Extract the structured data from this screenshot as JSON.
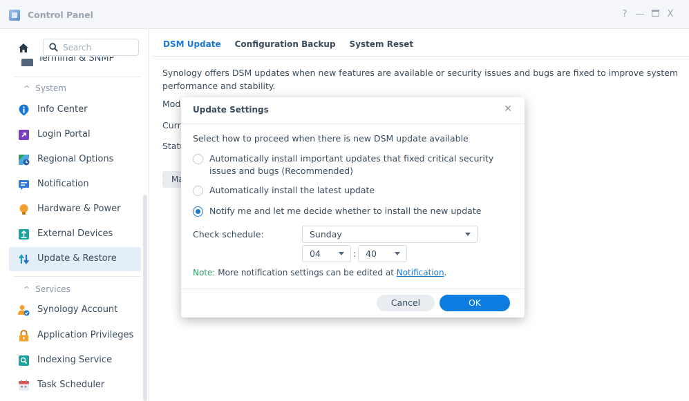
{
  "window": {
    "title": "Control Panel",
    "controls": {
      "help": "?",
      "minimize": "—",
      "maximize": "□",
      "close": "X"
    }
  },
  "sidebar": {
    "search_placeholder": "Search",
    "partial_item": "Terminal & SNMP",
    "groups": [
      {
        "title": "System",
        "items": [
          {
            "label": "Info Center",
            "icon": "info-icon",
            "color": "#1a79d5"
          },
          {
            "label": "Login Portal",
            "icon": "login-portal-icon",
            "color": "#7a3fbf"
          },
          {
            "label": "Regional Options",
            "icon": "regional-options-icon",
            "color": "#2d9c5d"
          },
          {
            "label": "Notification",
            "icon": "notification-icon",
            "color": "#2f7ad8"
          },
          {
            "label": "Hardware & Power",
            "icon": "lightbulb-icon",
            "color": "#f2a02d"
          },
          {
            "label": "External Devices",
            "icon": "external-devices-icon",
            "color": "#19a6a0"
          },
          {
            "label": "Update & Restore",
            "icon": "update-restore-icon",
            "color": "#1aa0b8",
            "active": true
          }
        ]
      },
      {
        "title": "Services",
        "items": [
          {
            "label": "Synology Account",
            "icon": "synology-account-icon",
            "color": "#f2a02d"
          },
          {
            "label": "Application Privileges",
            "icon": "lock-icon",
            "color": "#f2a02d"
          },
          {
            "label": "Indexing Service",
            "icon": "indexing-service-icon",
            "color": "#19a6a0"
          },
          {
            "label": "Task Scheduler",
            "icon": "calendar-icon",
            "color": "#e05050"
          }
        ]
      }
    ]
  },
  "main": {
    "tabs": [
      "DSM Update",
      "Configuration Backup",
      "System Reset"
    ],
    "active_tab": "DSM Update",
    "description": "Synology offers DSM updates when new features are available or security issues and bugs are fixed to improve system performance and stability.",
    "labels_partial": [
      "Mode",
      "Curr",
      "Statu"
    ],
    "manual_button_partial": "Ma"
  },
  "dialog": {
    "title": "Update Settings",
    "intro": "Select how to proceed when there is new DSM update available",
    "options": [
      {
        "label": "Automatically install important updates that fixed critical security issues and bugs (Recommended)",
        "checked": false
      },
      {
        "label": "Automatically install the latest update",
        "checked": false
      },
      {
        "label": "Notify me and let me decide whether to install the new update",
        "checked": true
      }
    ],
    "schedule_label": "Check schedule:",
    "day": "Sunday",
    "hour": "04",
    "time_separator": ":",
    "minute": "40",
    "note_prefix": "Note:",
    "note_text": " More notification settings can be edited at ",
    "note_link": "Notification",
    "note_end": ".",
    "cancel_label": "Cancel",
    "ok_label": "OK"
  }
}
